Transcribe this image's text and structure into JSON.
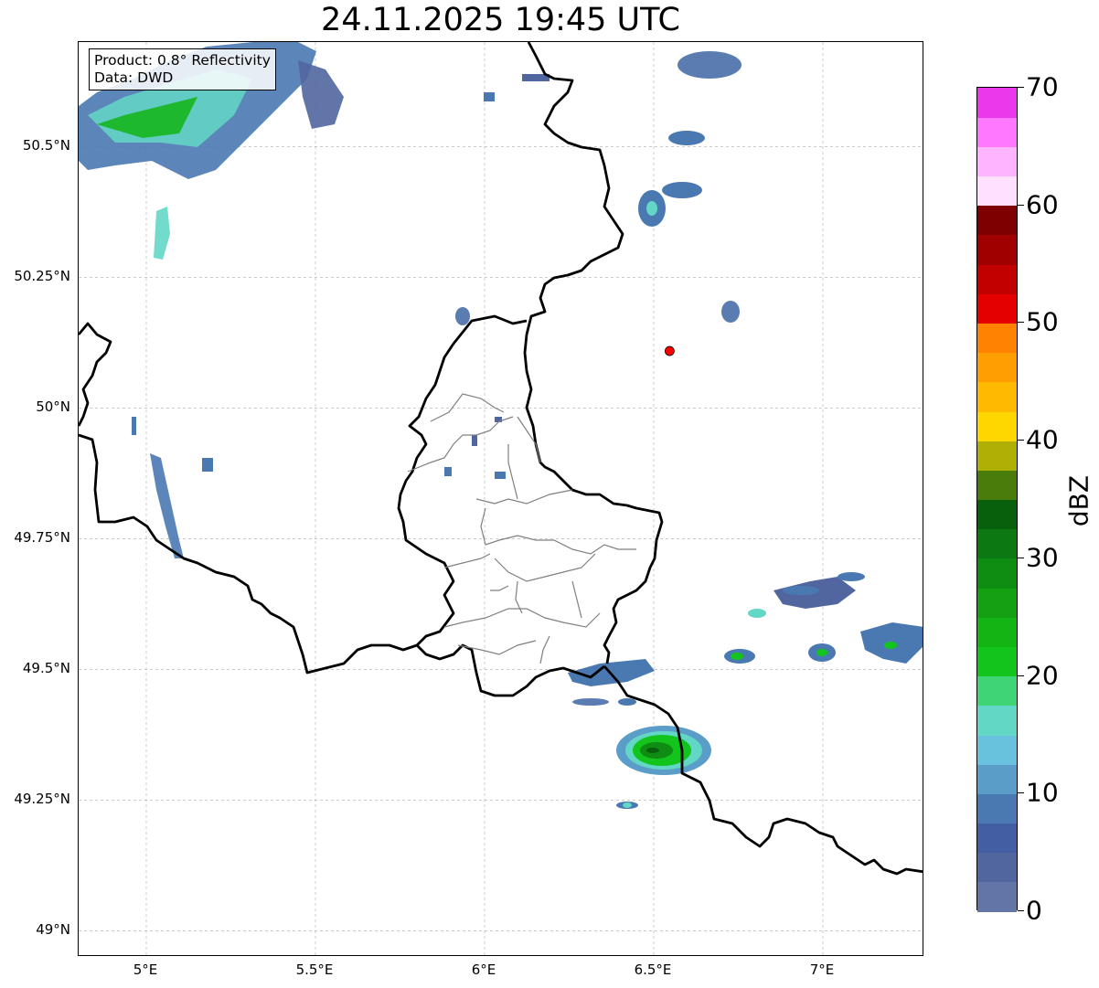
{
  "title": "24.11.2025 19:45 UTC",
  "info": {
    "product": "Product: 0.8° Reflectivity",
    "data": "Data: DWD"
  },
  "axes": {
    "lat_ticks": [
      {
        "label": "50.5°N",
        "value": 50.5
      },
      {
        "label": "50.25°N",
        "value": 50.25
      },
      {
        "label": "50°N",
        "value": 50.0
      },
      {
        "label": "49.75°N",
        "value": 49.75
      },
      {
        "label": "49.5°N",
        "value": 49.5
      },
      {
        "label": "49.25°N",
        "value": 49.25
      },
      {
        "label": "49°N",
        "value": 49.0
      }
    ],
    "lon_ticks": [
      {
        "label": "5°E",
        "value": 5.0
      },
      {
        "label": "5.5°E",
        "value": 5.5
      },
      {
        "label": "6°E",
        "value": 6.0
      },
      {
        "label": "6.5°E",
        "value": 6.5
      },
      {
        "label": "7°E",
        "value": 7.0
      }
    ],
    "lon_range": [
      4.8,
      7.3
    ],
    "lat_range": [
      48.95,
      50.7
    ],
    "grid": true
  },
  "radar_site": {
    "lon": 6.547,
    "lat": 50.109,
    "color": "#ff0000"
  },
  "colorbar": {
    "unit": "dBZ",
    "range": [
      0,
      70
    ],
    "tick_labels": [
      "0",
      "10",
      "20",
      "30",
      "40",
      "50",
      "60",
      "70"
    ],
    "colors": [
      "#6375a7",
      "#51669f",
      "#435ea3",
      "#4a79b1",
      "#5a9dc8",
      "#68c2de",
      "#63d7c5",
      "#3fd474",
      "#12c41c",
      "#12b514",
      "#13a013",
      "#0f8c12",
      "#0c7811",
      "#085f0c",
      "#497c0b",
      "#aeb005",
      "#ffd700",
      "#ffba00",
      "#ff9e00",
      "#ff8200",
      "#e40000",
      "#c20000",
      "#a00000",
      "#7e0000",
      "#ffe0ff",
      "#ffb4ff",
      "#ff78ff",
      "#ea38ea"
    ]
  },
  "echoes": [
    {
      "lon": 4.95,
      "lat": 50.6,
      "dbz": 14
    },
    {
      "lon": 5.1,
      "lat": 50.55,
      "dbz": 16
    },
    {
      "lon": 5.25,
      "lat": 50.62,
      "dbz": 12
    },
    {
      "lon": 5.45,
      "lat": 50.6,
      "dbz": 10
    },
    {
      "lon": 5.05,
      "lat": 50.33,
      "dbz": 12
    },
    {
      "lon": 5.03,
      "lat": 49.85,
      "dbz": 10
    },
    {
      "lon": 6.48,
      "lat": 50.4,
      "dbz": 14
    },
    {
      "lon": 6.52,
      "lat": 50.5,
      "dbz": 8
    },
    {
      "lon": 6.7,
      "lat": 50.65,
      "dbz": 6
    },
    {
      "lon": 6.5,
      "lat": 49.35,
      "dbz": 26
    },
    {
      "lon": 6.4,
      "lat": 49.48,
      "dbz": 8
    },
    {
      "lon": 6.25,
      "lat": 49.47,
      "dbz": 12
    },
    {
      "lon": 7.0,
      "lat": 49.53,
      "dbz": 12
    },
    {
      "lon": 7.2,
      "lat": 49.52,
      "dbz": 14
    },
    {
      "lon": 6.78,
      "lat": 49.52,
      "dbz": 10
    },
    {
      "lon": 6.9,
      "lat": 49.63,
      "dbz": 8
    }
  ]
}
